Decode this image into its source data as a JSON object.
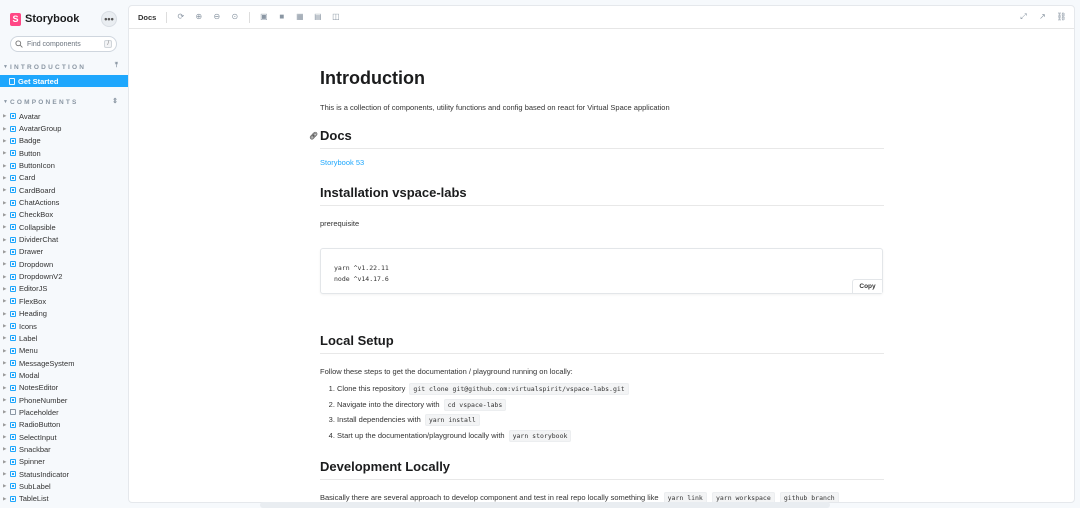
{
  "app": {
    "brand": "Storybook",
    "logo_letter": "S"
  },
  "sidebar": {
    "search_placeholder": "Find components",
    "search_shortcut": "/",
    "menu_icon": "ellipsis-icon",
    "sections": [
      {
        "label": "INTRODUCTION",
        "items": [
          "Get Started"
        ]
      },
      {
        "label": "COMPONENTS"
      }
    ],
    "active_item": "Get Started",
    "components": [
      "Avatar",
      "AvatarGroup",
      "Badge",
      "Button",
      "ButtonIcon",
      "Card",
      "CardBoard",
      "ChatActions",
      "CheckBox",
      "Collapsible",
      "DividerChat",
      "Drawer",
      "Dropdown",
      "DropdownV2",
      "EditorJS",
      "FlexBox",
      "Heading",
      "Icons",
      "Label",
      "Menu",
      "MessageSystem",
      "Modal",
      "NotesEditor",
      "PhoneNumber",
      "Placeholder",
      "RadioButton",
      "SelectInput",
      "Snackbar",
      "Spinner",
      "StatusIndicator",
      "SubLabel",
      "TableList"
    ]
  },
  "toolbar": {
    "tab": "Docs"
  },
  "doc": {
    "title": "Introduction",
    "intro": "This is a collection of components, utility functions and config based on react for Virtual Space application",
    "docs_heading": "Docs",
    "docs_link": "Storybook 53",
    "install_heading": "Installation vspace-labs",
    "prerequisite": "prerequisite",
    "code_block": "yarn ^v1.22.11\nnode ^v14.17.6",
    "copy_label": "Copy",
    "local_heading": "Local Setup",
    "local_intro": "Follow these steps to get the documentation / playground running on locally:",
    "steps": [
      {
        "text": "Clone this repository",
        "code": "git clone git@github.com:virtualspirit/vspace-labs.git"
      },
      {
        "text": "Navigate into the directory with",
        "code": "cd vspace-labs"
      },
      {
        "text": "Install dependencies with",
        "code": "yarn install"
      },
      {
        "text": "Start up the documentation/playground locally with",
        "code": "yarn storybook"
      }
    ],
    "dev_heading": "Development Locally",
    "dev_intro": "Basically there are several approach to develop component and test in real repo locally something like",
    "dev_codes": [
      "yarn link",
      "yarn workspace",
      "github branch"
    ]
  }
}
